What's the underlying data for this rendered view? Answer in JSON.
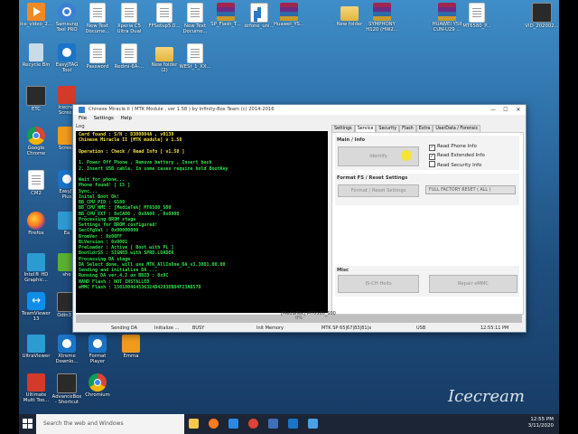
{
  "desktop": {
    "icons": [
      {
        "label": "ice_video_2...",
        "icon": "video",
        "c": "video"
      },
      {
        "label": "Samsung\nTool PRO",
        "icon": "samsung-tool",
        "c": "tool"
      },
      {
        "label": "New Text\nDocume...",
        "icon": "text-doc",
        "c": "doc"
      },
      {
        "label": "Xperia C5\nUltra Dual",
        "icon": "doc",
        "c": "doc"
      },
      {
        "label": "FFSetup5.0...",
        "icon": "doc",
        "c": "doc"
      },
      {
        "label": "New Text\nDocume...",
        "icon": "text-doc",
        "c": "doc"
      },
      {
        "label": "SP_Flash_T...",
        "icon": "rar",
        "c": "rar"
      },
      {
        "label": "drfone_uni...",
        "icon": "drfone",
        "c": "flash"
      },
      {
        "label": "Huawei_YS...",
        "icon": "rar",
        "c": "rar"
      },
      {
        "label": "New folder",
        "icon": "folder",
        "c": "folder"
      },
      {
        "label": "SYMPHONY\nH120 (HW2...",
        "icon": "rar",
        "c": "rar"
      },
      {
        "label": "HUAWEI Y5II\nCUN-U29 ...",
        "icon": "rar",
        "c": "rar"
      },
      {
        "label": "MT6580_P...",
        "icon": "doc",
        "c": "doc"
      },
      {
        "label": "VID_202002...",
        "icon": "video",
        "c": "dark"
      },
      {
        "label": "Recycle Bin",
        "icon": "recycle-bin",
        "c": "bin"
      },
      {
        "label": "EasyJTAG\nTool",
        "icon": "easyjtag",
        "c": "app"
      },
      {
        "label": "Password",
        "icon": "doc",
        "c": "doc"
      },
      {
        "label": "Redmi-6A-...",
        "icon": "doc",
        "c": "doc"
      },
      {
        "label": "New folder\n(2)",
        "icon": "folder",
        "c": "folder"
      },
      {
        "label": "WESt_1_XX...",
        "icon": "doc",
        "c": "doc"
      },
      {
        "label": "ETC",
        "icon": "etc",
        "c": "dark"
      },
      {
        "label": "Icecrea\nScreen",
        "icon": "icecream",
        "c": "red"
      },
      {
        "label": "Google\nChrome",
        "icon": "chrome",
        "c": "chrome"
      },
      {
        "label": "Screen",
        "icon": "screen",
        "c": "orange"
      },
      {
        "label": "CM2",
        "icon": "doc",
        "c": "doc"
      },
      {
        "label": "EasyJT\nPlus",
        "icon": "easyjtag",
        "c": "app"
      },
      {
        "label": "Firefox",
        "icon": "firefox",
        "c": "firefox"
      },
      {
        "label": "Ea",
        "icon": "app",
        "c": "teal"
      },
      {
        "label": "Intel® HD\nGraphic...",
        "icon": "intel",
        "c": "teal"
      },
      {
        "label": "she",
        "icon": "app",
        "c": "green"
      },
      {
        "label": "TeamViewer\n13",
        "icon": "teamviewer",
        "c": "tv"
      },
      {
        "label": "Odin3_v",
        "icon": "odin",
        "c": "dark"
      },
      {
        "label": "UltraViewer",
        "icon": "ultraviewer",
        "c": "teal"
      },
      {
        "label": "Xtreme\nDownlo...",
        "icon": "xtreme",
        "c": "app"
      },
      {
        "label": "Format\nPlayer",
        "icon": "format-player",
        "c": "app"
      },
      {
        "label": "Emma",
        "icon": "emma",
        "c": "orange"
      },
      {
        "label": "Ultimate\nMulti Too...",
        "icon": "ultimate",
        "c": "red"
      },
      {
        "label": "AdvanceBox\n- Shortcut",
        "icon": "advancebox",
        "c": "dark"
      },
      {
        "label": "Chromium",
        "icon": "chromium",
        "c": "chrome"
      }
    ]
  },
  "window": {
    "title": "Chinese Miracle II ( MTK Module , ver 1.58 ) by Infinity-Box Team (c) 2014-2016",
    "minimize": "—",
    "maximize": "☐",
    "close": "✕",
    "menu": [
      "File",
      "Settings",
      "Help"
    ],
    "log_label": "Log",
    "log_lines": [
      {
        "t": "Card found : S/N : D300004A , v0139",
        "c": "y"
      },
      {
        "t": "Chinese Miracle II [MTK module] v 1.58",
        "c": "y"
      },
      {
        "t": "",
        "c": "g"
      },
      {
        "t": "Operation : Check / Read Info [ v1.58 ]",
        "c": "y"
      },
      {
        "t": "",
        "c": "g"
      },
      {
        "t": "1. Power Off Phone , Remove battery , Insert back",
        "c": "g"
      },
      {
        "t": "2. Insert USB cable. In some cases require hold BootKey",
        "c": "g"
      },
      {
        "t": "",
        "c": "g"
      },
      {
        "t": "Wait for phone...",
        "c": "g"
      },
      {
        "t": "Phone found! [ 15 ]",
        "c": "g"
      },
      {
        "t": "Sync...",
        "c": "g"
      },
      {
        "t": "Inital Boot Ok!",
        "c": "g"
      },
      {
        "t": "BB_CPU_PID : 6580",
        "c": "g"
      },
      {
        "t": "BB_CPU_NME : [MediaTek] MT6580_S00",
        "c": "g"
      },
      {
        "t": "BB_CPU_EXT : 0xCA00 , 0x8A00 , 0x0000",
        "c": "g"
      },
      {
        "t": "Processing BROM stage",
        "c": "g"
      },
      {
        "t": "Settings for BROM configured!",
        "c": "g"
      },
      {
        "t": "SecCfgVal : 0x00000000",
        "c": "g"
      },
      {
        "t": "BromVer  : 0x00FF",
        "c": "g"
      },
      {
        "t": "BLVersion : 0x0001",
        "c": "g"
      },
      {
        "t": "PreLoader : Active [ Boot with PL ]",
        "c": "g"
      },
      {
        "t": "BootLdrSS : SIGNED with SPRD.LOADER",
        "c": "g"
      },
      {
        "t": "Processing DA stage",
        "c": "g"
      },
      {
        "t": "DA Select done, will use MTK_AllInOne_DA_v3.3001.00.00",
        "c": "g"
      },
      {
        "t": "Sending and initialize DA ...",
        "c": "g"
      },
      {
        "t": "Running DA ver.4.2 on BBID : 0x9C",
        "c": "g"
      },
      {
        "t": "NAND Flash : NOT INSTALLED",
        "c": "g"
      },
      {
        "t": "eMMC Flash : 150100464536324D4203EBD4F23AB57D",
        "c": "g"
      }
    ],
    "tabs": [
      "Settings",
      "Service",
      "Security",
      "Flash",
      "Extra",
      "UserData / Forensic"
    ],
    "selected_tab": "Service",
    "main_info": {
      "title": "Main / Info",
      "button": "Identify",
      "checks": [
        {
          "label": "Read Phone Info",
          "checked": true
        },
        {
          "label": "Read Extended Info",
          "checked": true
        },
        {
          "label": "Read Security Info",
          "checked": false
        }
      ]
    },
    "format": {
      "title": "Format FS / Reset Settings",
      "button": "Format / Reset Settings",
      "select": "FULL FACTORY RESET ( ALL )"
    },
    "misc": {
      "title": "Misc",
      "btn1": "IS-CH Hello",
      "btn2": "Repair eMMC"
    },
    "progress": {
      "text": "0%",
      "value": 0
    },
    "version_line": "[MediaTek] MT6580_S00",
    "status": [
      "Sending DA",
      "Initialize ...",
      "BUSY",
      "Init Memory",
      "MTK SP 65|67|83|81|x",
      "USB",
      "12:55:11 PM"
    ]
  },
  "taskbar": {
    "search_placeholder": "Search the web and Windows",
    "time": "12:55 PM",
    "date": "3/11/2020"
  },
  "watermark": "Icecream"
}
